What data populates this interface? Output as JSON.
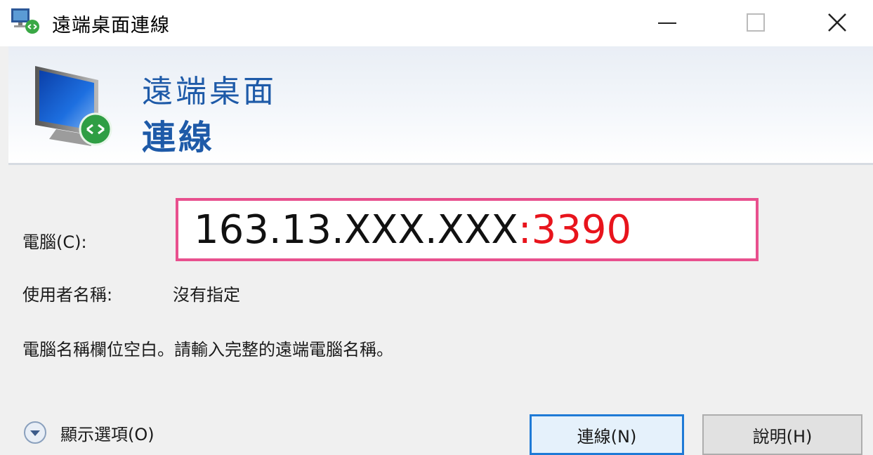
{
  "window": {
    "title": "遠端桌面連線",
    "controls": {
      "minimize": "minimize-icon",
      "maximize": "maximize-icon",
      "close": "close-icon"
    }
  },
  "banner": {
    "line1": "遠端桌面",
    "line2": "連線",
    "text_color": "#1e5aa8"
  },
  "form": {
    "computer_label": "電腦(C):",
    "computer_value_host": "163.13.XXX.XXX",
    "computer_value_port": ":3390",
    "user_label": "使用者名稱:",
    "user_value": "沒有指定",
    "hint": "電腦名稱欄位空白。請輸入完整的遠端電腦名稱。",
    "highlight_color": "#e8508e",
    "port_color": "#e8141c"
  },
  "footer": {
    "options_label": "顯示選項(O)",
    "connect_button": "連線(N)",
    "help_button": "說明(H)"
  }
}
